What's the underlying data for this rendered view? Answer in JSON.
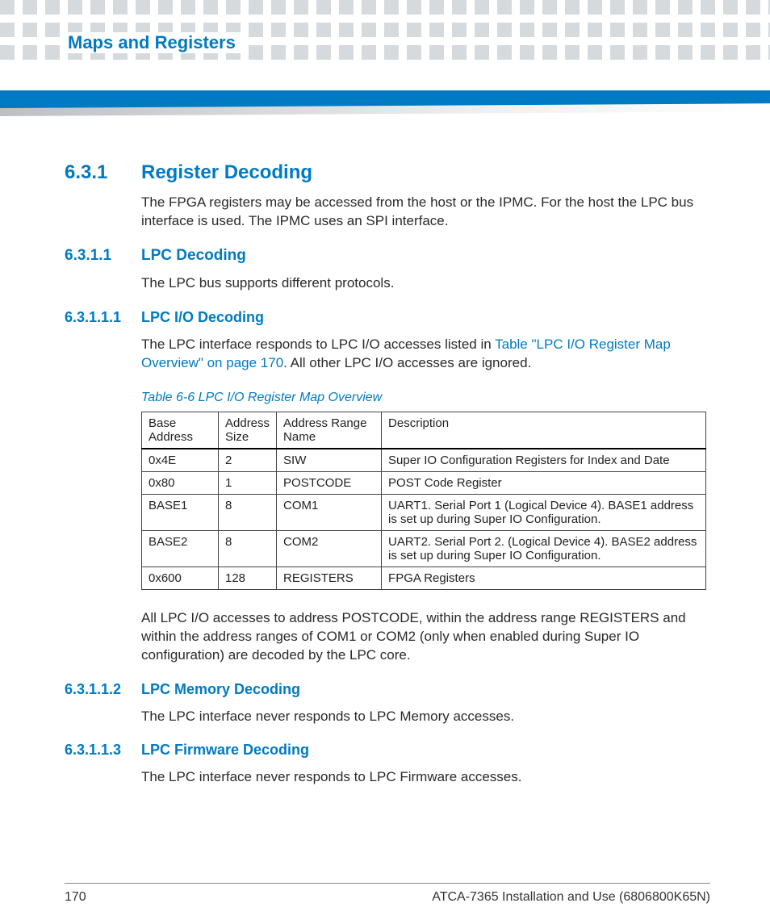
{
  "header": {
    "chapter_title": "Maps and Registers"
  },
  "sections": {
    "s631": {
      "num": "6.3.1",
      "title": "Register Decoding",
      "body": "The FPGA registers may be accessed from the host or the IPMC. For the host the LPC bus interface is used. The IPMC uses an SPI interface."
    },
    "s6311": {
      "num": "6.3.1.1",
      "title": "LPC Decoding",
      "body": "The LPC bus supports different protocols."
    },
    "s63111": {
      "num": "6.3.1.1.1",
      "title": "LPC I/O Decoding",
      "body_pre": "The LPC interface responds to LPC I/O accesses listed in ",
      "xref": "Table \"LPC I/O Register Map Overview\" on page 170",
      "body_post": ". All other LPC I/O accesses are ignored.",
      "body_after_table": "All LPC I/O accesses to address POSTCODE, within the address range REGISTERS and within the address ranges of COM1 or COM2 (only when enabled during Super IO configuration) are decoded by the LPC core."
    },
    "s63112": {
      "num": "6.3.1.1.2",
      "title": "LPC Memory Decoding",
      "body": "The LPC interface never responds to LPC Memory accesses."
    },
    "s63113": {
      "num": "6.3.1.1.3",
      "title": "LPC Firmware Decoding",
      "body": "The LPC interface never responds to LPC Firmware accesses."
    }
  },
  "table": {
    "caption": "Table 6-6  LPC I/O Register Map Overview",
    "headers": [
      "Base Address",
      "Address Size",
      "Address Range Name",
      "Description"
    ],
    "rows": [
      [
        "0x4E",
        "2",
        "SIW",
        "Super IO Configuration Registers for Index and Date"
      ],
      [
        "0x80",
        "1",
        "POSTCODE",
        "POST Code Register"
      ],
      [
        "BASE1",
        "8",
        "COM1",
        "UART1. Serial Port 1 (Logical Device 4). BASE1 address is set up during Super IO Configuration."
      ],
      [
        "BASE2",
        "8",
        "COM2",
        "UART2. Serial Port 2. (Logical Device 4). BASE2 address is set up during Super IO Configuration."
      ],
      [
        "0x600",
        "128",
        "REGISTERS",
        "FPGA Registers"
      ]
    ]
  },
  "footer": {
    "page": "170",
    "doc": "ATCA-7365 Installation and Use (6806800K65N)"
  }
}
